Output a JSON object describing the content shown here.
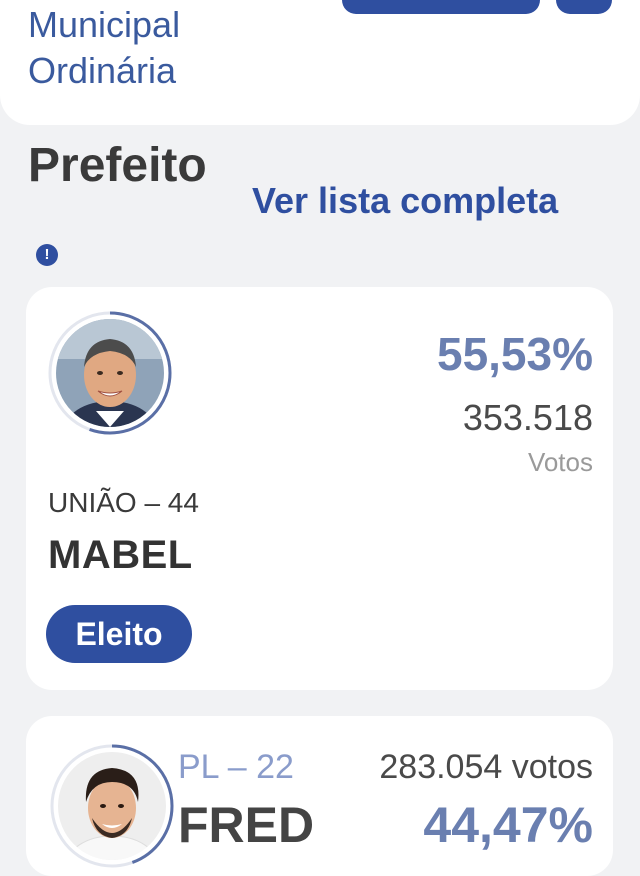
{
  "header": {
    "title_line1": "Municipal",
    "title_line2": "Ordinária"
  },
  "section": {
    "title": "Prefeito",
    "see_all_link": "Ver lista completa",
    "info_symbol": "!"
  },
  "colors": {
    "brand": "#2f4fa0",
    "accent_light": "#6a7fb0",
    "background": "#f1f2f4"
  },
  "candidates": [
    {
      "party": "UNIÃO – 44",
      "name": "MABEL",
      "percent": "55,53%",
      "votes": "353.518",
      "votes_label": "Votos",
      "status": "Eleito",
      "vote_share": 0.5553
    },
    {
      "party": "PL – 22",
      "name": "FRED",
      "percent": "44,47%",
      "votes_text": "283.054 votos",
      "vote_share": 0.4447
    }
  ]
}
